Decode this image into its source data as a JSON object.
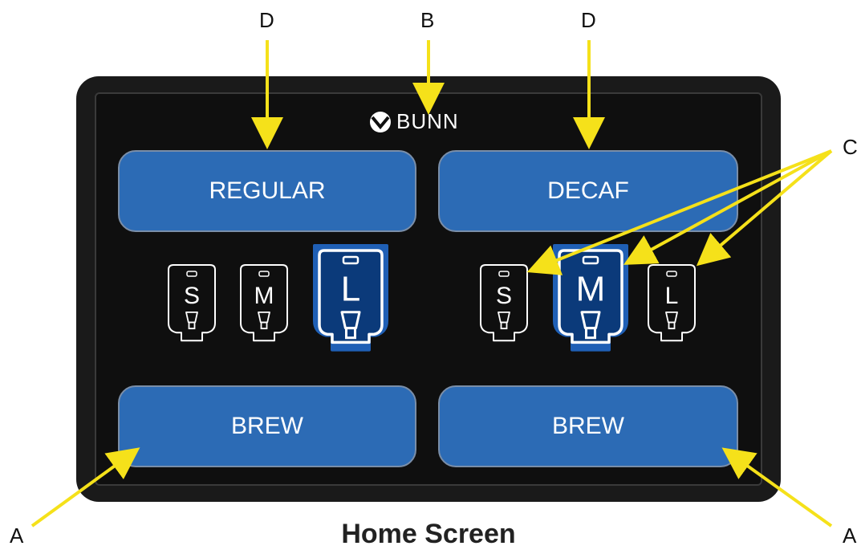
{
  "callouts": {
    "top_left": "D",
    "top_center": "B",
    "top_right": "D",
    "right": "C",
    "bottom_left": "A",
    "bottom_right": "A"
  },
  "logo": {
    "text": "BUNN"
  },
  "buttons": {
    "regular": "REGULAR",
    "decaf": "DECAF",
    "brew_left": "BREW",
    "brew_right": "BREW"
  },
  "sizes_left": [
    {
      "label": "S",
      "selected": false
    },
    {
      "label": "M",
      "selected": false
    },
    {
      "label": "L",
      "selected": true
    }
  ],
  "sizes_right": [
    {
      "label": "S",
      "selected": false
    },
    {
      "label": "M",
      "selected": true
    },
    {
      "label": "L",
      "selected": false
    }
  ],
  "caption": "Home Screen",
  "colors": {
    "panel": "#1a1a1a",
    "button": "#2c6bb5",
    "arrow": "#f5e11a",
    "selected_glow": "#1f5fb5"
  }
}
